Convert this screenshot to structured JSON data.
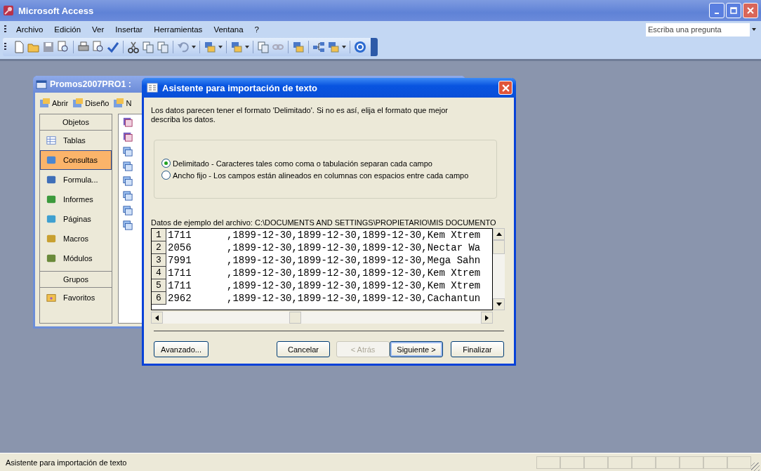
{
  "window": {
    "title": "Microsoft Access"
  },
  "menu": [
    "Archivo",
    "Edición",
    "Ver",
    "Insertar",
    "Herramientas",
    "Ventana",
    "?"
  ],
  "help_search": {
    "placeholder": "Escriba una pregunta"
  },
  "database_window": {
    "title": "Promos2007PRO1 :",
    "toolbar": [
      "Abrir",
      "Diseño",
      "N"
    ],
    "objects_header": "Objetos",
    "objects": [
      {
        "label": "Tablas",
        "kind": "table",
        "selected": false
      },
      {
        "label": "Consultas",
        "kind": "query",
        "selected": true
      },
      {
        "label": "Formula...",
        "kind": "form",
        "selected": false
      },
      {
        "label": "Informes",
        "kind": "report",
        "selected": false
      },
      {
        "label": "Páginas",
        "kind": "page",
        "selected": false
      },
      {
        "label": "Macros",
        "kind": "macro",
        "selected": false
      },
      {
        "label": "Módulos",
        "kind": "module",
        "selected": false
      }
    ],
    "groups_header": "Grupos",
    "groups": [
      {
        "label": "Favoritos",
        "selected": false
      }
    ],
    "list_items": [
      {
        "kind": "wizard"
      },
      {
        "kind": "wizard"
      },
      {
        "kind": "query"
      },
      {
        "kind": "query"
      },
      {
        "kind": "query"
      },
      {
        "kind": "query"
      },
      {
        "kind": "query"
      },
      {
        "kind": "query"
      }
    ]
  },
  "dialog": {
    "title": "Asistente para importación de texto",
    "description": "Los datos parecen tener el formato 'Delimitado'. Si no es así, elija el formato que mejor describa los datos.",
    "options": [
      {
        "label": "Delimitado - Caracteres tales como coma o tabulación separan cada campo",
        "selected": true
      },
      {
        "label": "Ancho fijo - Los campos están alineados en columnas con espacios entre cada campo",
        "selected": false
      }
    ],
    "sample_label": "Datos de ejemplo del archivo: C:\\DOCUMENTS AND SETTINGS\\PROPIETARIO\\MIS DOCUMENTO",
    "sample_rows": [
      {
        "number": "1",
        "text": "1711      ,1899-12-30,1899-12-30,1899-12-30,Kem Xtrem"
      },
      {
        "number": "2",
        "text": "2056      ,1899-12-30,1899-12-30,1899-12-30,Nectar Wa"
      },
      {
        "number": "3",
        "text": "7991      ,1899-12-30,1899-12-30,1899-12-30,Mega Sahn"
      },
      {
        "number": "4",
        "text": "1711      ,1899-12-30,1899-12-30,1899-12-30,Kem Xtrem"
      },
      {
        "number": "5",
        "text": "1711      ,1899-12-30,1899-12-30,1899-12-30,Kem Xtrem"
      },
      {
        "number": "6",
        "text": "2962      ,1899-12-30,1899-12-30,1899-12-30,Cachantun"
      }
    ],
    "buttons": [
      {
        "label": "Avanzado...",
        "disabled": false,
        "default": false
      },
      {
        "label": "Cancelar",
        "disabled": false,
        "default": false
      },
      {
        "label": "< Atrás",
        "disabled": true,
        "default": false
      },
      {
        "label": "Siguiente >",
        "disabled": false,
        "default": true
      },
      {
        "label": "Finalizar",
        "disabled": false,
        "default": false
      }
    ]
  },
  "status_bar": {
    "text": "Asistente para importación de texto"
  }
}
